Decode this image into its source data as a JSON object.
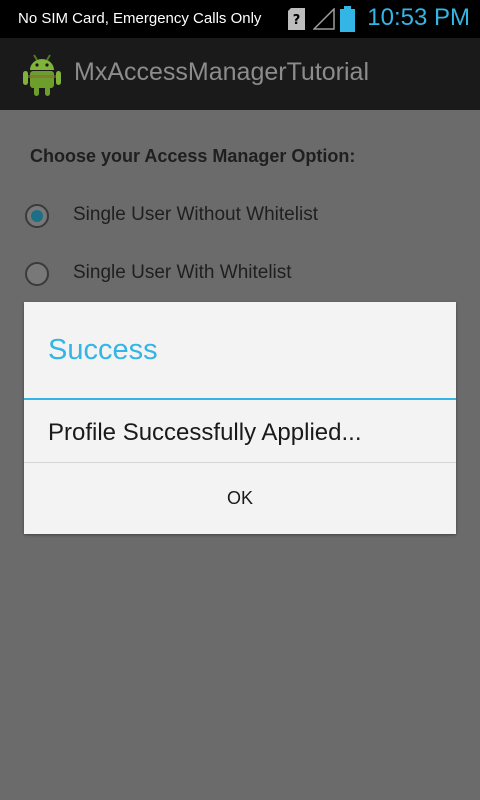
{
  "status_bar": {
    "carrier_text": "No SIM Card, Emergency Calls Only",
    "time": "10:53 PM",
    "icons": [
      "sim-missing-icon",
      "signal-icon",
      "battery-icon"
    ],
    "accent_color": "#33b5e5"
  },
  "action_bar": {
    "app_icon": "android-icon",
    "title": "MxAccessManagerTutorial"
  },
  "main": {
    "prompt": "Choose your Access Manager Option:",
    "options": [
      {
        "label": "Single User Without Whitelist",
        "checked": true
      },
      {
        "label": "Single User With Whitelist",
        "checked": false
      }
    ]
  },
  "dialog": {
    "title": "Success",
    "message": "Profile Successfully Applied...",
    "ok_label": "OK",
    "title_color": "#33b5e5"
  }
}
